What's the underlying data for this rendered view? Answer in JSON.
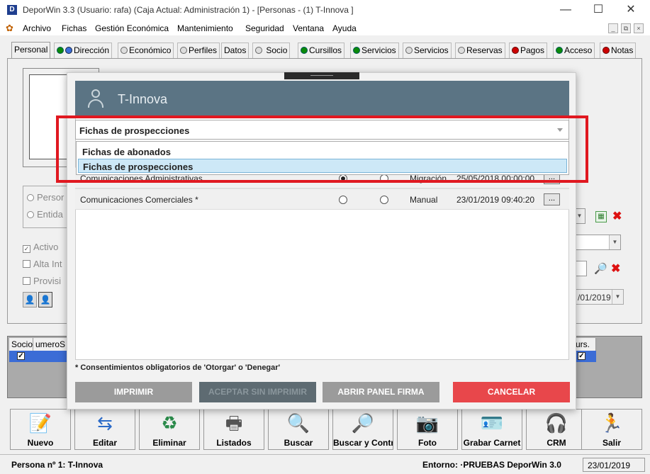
{
  "window": {
    "title": "DeporWin 3.3  (Usuario: rafa)  (Caja Actual: Administración 1) - [Personas - (1) T-Innova  ]",
    "icon_letter": "D",
    "minimize": "—",
    "maximize": "☐",
    "close": "✕"
  },
  "menu": {
    "items": [
      "Archivo",
      "Fichas",
      "Gestión Económica",
      "Mantenimiento",
      "Seguridad",
      "Ventana",
      "Ayuda"
    ],
    "mdi": [
      "_",
      "⧉",
      "×"
    ]
  },
  "tabs": [
    {
      "label": "Personal",
      "dot": "none"
    },
    {
      "label": "Dirección",
      "dot": "green-blue"
    },
    {
      "label": "Económico",
      "dot": "grey"
    },
    {
      "label": "Perfiles",
      "dot": "grey"
    },
    {
      "label": "Datos",
      "dot": "none"
    },
    {
      "label": "Socio",
      "dot": "grey"
    },
    {
      "label": "Cursillos",
      "dot": "green"
    },
    {
      "label": "Servicios",
      "dot": "green"
    },
    {
      "label": "Servicios",
      "dot": "grey"
    },
    {
      "label": "Reservas",
      "dot": "grey"
    },
    {
      "label": "Pagos",
      "dot": "red"
    },
    {
      "label": "Acceso",
      "dot": "green"
    },
    {
      "label": "Notas",
      "dot": "red"
    }
  ],
  "background_form": {
    "radio_persona": "Persor",
    "radio_entidad": "Entida",
    "check_activo": "Activo",
    "check_alta": "Alta Int",
    "check_provisional": "Provisi",
    "date_value": "/01/2019"
  },
  "grid": {
    "headers": [
      "Socio",
      "umeroS",
      "urs."
    ]
  },
  "modal": {
    "entity_name": "T-Innova",
    "select_value": "Fichas de prospecciones",
    "dropdown_options": [
      "Fichas de abonados",
      "Fichas de prospecciones"
    ],
    "dropdown_selected": 1,
    "rows": [
      {
        "label": "Comunicaciones Administrativas",
        "origin": "Migración",
        "date": "25/05/2018 00:00:00",
        "otorgar": true
      },
      {
        "label": "Comunicaciones Comerciales *",
        "origin": "Manual",
        "date": "23/01/2019 09:40:20",
        "otorgar": false
      }
    ],
    "more_label": "...",
    "footnote": "* Consentimientos obligatorios de 'Otorgar' o 'Denegar'",
    "buttons": {
      "print": "IMPRIMIR",
      "accept_no_print": "ACEPTAR SIN IMPRIMIR",
      "open_sign": "ABRIR PANEL FIRMA",
      "cancel": "CANCELAR"
    },
    "colors": {
      "header": "#5b7484",
      "cancel": "#e8474b",
      "selected_option": "#cde8f7"
    }
  },
  "toolbar": {
    "buttons": [
      {
        "label": "Nuevo",
        "icon": "new-document-icon"
      },
      {
        "label": "Editar",
        "icon": "refresh-arrows-icon"
      },
      {
        "label": "Eliminar",
        "icon": "recycle-bin-icon"
      },
      {
        "label": "Listados",
        "icon": "printer-icon"
      },
      {
        "label": "Buscar",
        "icon": "magnifier-icon"
      },
      {
        "label": "Buscar y Contr",
        "icon": "search-document-icon"
      },
      {
        "label": "Foto",
        "icon": "camera-icon"
      },
      {
        "label": "Grabar Carnet",
        "icon": "id-card-icon"
      },
      {
        "label": "CRM",
        "icon": "headset-icon"
      },
      {
        "label": "Salir",
        "icon": "running-man-icon"
      }
    ]
  },
  "status": {
    "left": "Persona nº 1: T-Innova",
    "environment": "Entorno: ·PRUEBAS DeporWin 3.0",
    "date": "23/01/2019"
  },
  "annotation": {
    "color": "#e01820"
  }
}
